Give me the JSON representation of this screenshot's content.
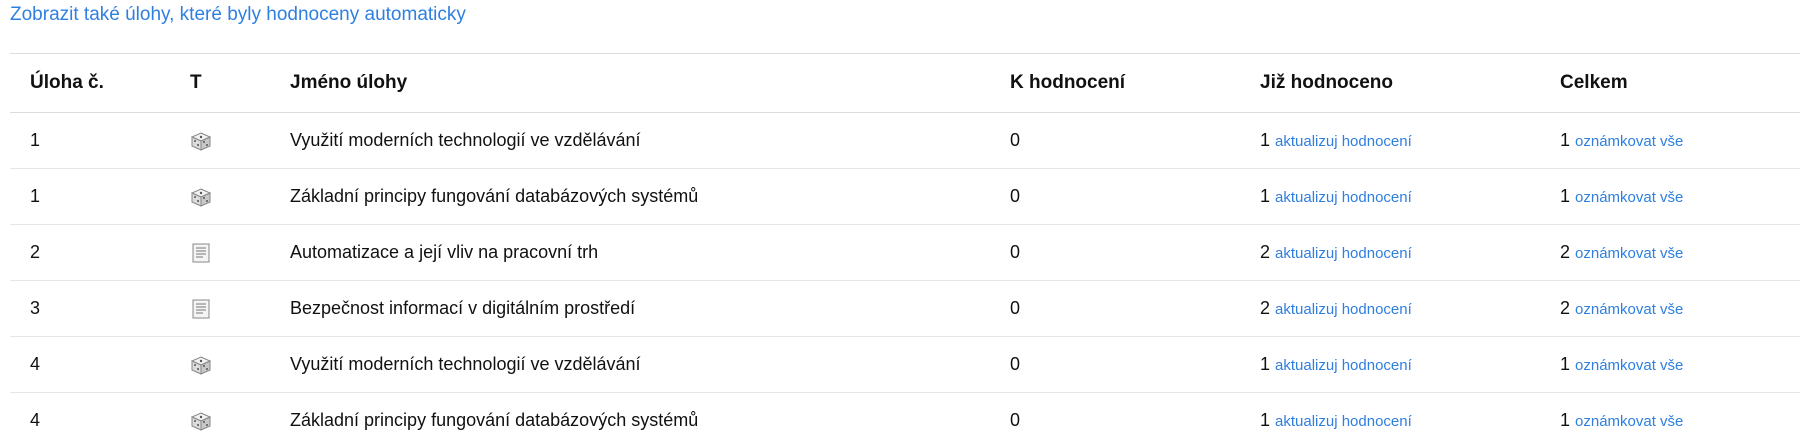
{
  "top_link": "Zobrazit také úlohy, které byly hodnoceny automaticky",
  "headers": {
    "num": "Úloha č.",
    "type": "T",
    "name": "Jméno úlohy",
    "to_grade": "K hodnocení",
    "graded": "Již hodnoceno",
    "total": "Celkem"
  },
  "rows": [
    {
      "num": "1",
      "icon": "dice-icon",
      "name": "Využití moderních technologií ve vzdělávání",
      "to_grade": "0",
      "graded": "1",
      "graded_link": "aktualizuj hodnocení",
      "total": "1",
      "total_link": "oznámkovat vše"
    },
    {
      "num": "1",
      "icon": "dice-icon",
      "name": "Základní principy fungování databázových systémů",
      "to_grade": "0",
      "graded": "1",
      "graded_link": "aktualizuj hodnocení",
      "total": "1",
      "total_link": "oznámkovat vše"
    },
    {
      "num": "2",
      "icon": "document-icon",
      "name": "Automatizace a její vliv na pracovní trh",
      "to_grade": "0",
      "graded": "2",
      "graded_link": "aktualizuj hodnocení",
      "total": "2",
      "total_link": "oznámkovat vše"
    },
    {
      "num": "3",
      "icon": "document-icon",
      "name": "Bezpečnost informací v digitálním prostředí",
      "to_grade": "0",
      "graded": "2",
      "graded_link": "aktualizuj hodnocení",
      "total": "2",
      "total_link": "oznámkovat vše"
    },
    {
      "num": "4",
      "icon": "dice-icon",
      "name": "Využití moderních technologií ve vzdělávání",
      "to_grade": "0",
      "graded": "1",
      "graded_link": "aktualizuj hodnocení",
      "total": "1",
      "total_link": "oznámkovat vše"
    },
    {
      "num": "4",
      "icon": "dice-icon",
      "name": "Základní principy fungování databázových systémů",
      "to_grade": "0",
      "graded": "1",
      "graded_link": "aktualizuj hodnocení",
      "total": "1",
      "total_link": "oznámkovat vše"
    }
  ]
}
